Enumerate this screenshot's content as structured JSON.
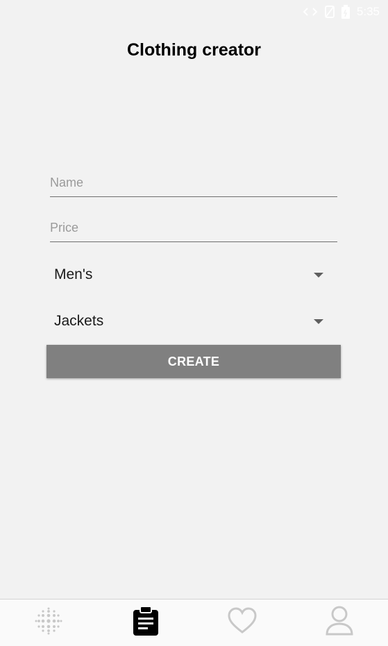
{
  "status_bar": {
    "time": "5:35",
    "icons": [
      "data-arrows-icon",
      "no-signal-icon",
      "battery-icon"
    ]
  },
  "header": {
    "title": "Clothing creator"
  },
  "form": {
    "name_placeholder": "Name",
    "name_value": "",
    "price_placeholder": "Price",
    "price_value": "",
    "gender_selected": "Men's",
    "category_selected": "Jackets",
    "create_label": "CREATE"
  },
  "bottom_nav": {
    "items": [
      {
        "icon": "dots-grid-icon",
        "active": false
      },
      {
        "icon": "clipboard-icon",
        "active": true
      },
      {
        "icon": "heart-icon",
        "active": false
      },
      {
        "icon": "profile-icon",
        "active": false
      }
    ]
  },
  "colors": {
    "background": "#f2f2f2",
    "button": "#808080",
    "underline": "#6f6f6f",
    "active_nav": "#000000",
    "inactive_nav": "#c8c8c8"
  }
}
